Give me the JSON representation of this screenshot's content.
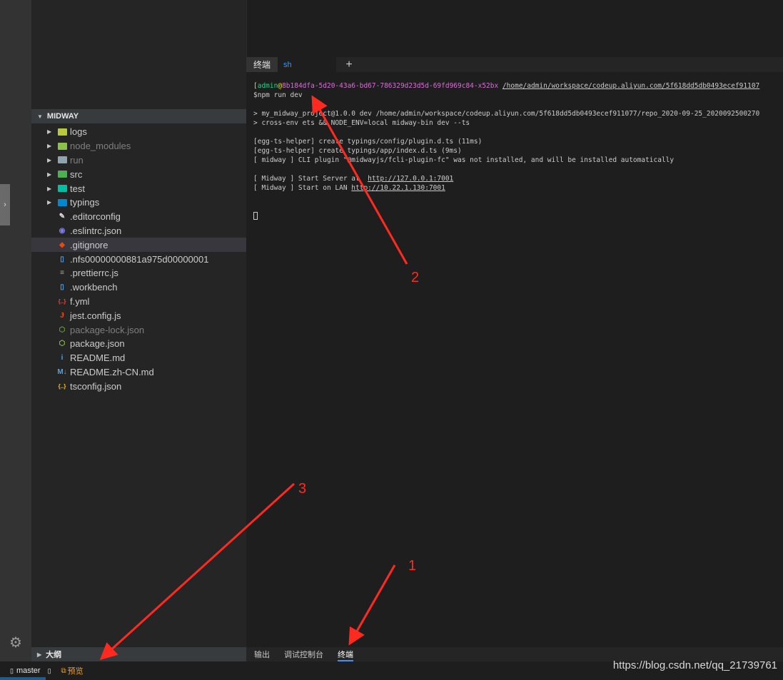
{
  "sidebar": {
    "section_title": "MIDWAY",
    "outline_title": "大纲",
    "items": [
      {
        "label": "logs",
        "type": "folder",
        "icon": "folder-logs-icon",
        "color": "#b8c93c",
        "dim": false
      },
      {
        "label": "node_modules",
        "type": "folder",
        "icon": "folder-node-icon",
        "color": "#8bc34a",
        "dim": true
      },
      {
        "label": "run",
        "type": "folder",
        "icon": "folder-icon",
        "color": "#90a4ae",
        "dim": true
      },
      {
        "label": "src",
        "type": "folder",
        "icon": "folder-src-icon",
        "color": "#4caf50",
        "dim": false
      },
      {
        "label": "test",
        "type": "folder",
        "icon": "folder-test-icon",
        "color": "#00bfa5",
        "dim": false
      },
      {
        "label": "typings",
        "type": "folder",
        "icon": "folder-typings-icon",
        "color": "#0288d1",
        "dim": false
      },
      {
        "label": ".editorconfig",
        "type": "file",
        "icon": "editorconfig-icon",
        "glyph": "✎",
        "color": "#e0e0e0",
        "dim": false
      },
      {
        "label": ".eslintrc.json",
        "type": "file",
        "icon": "eslint-icon",
        "glyph": "◉",
        "color": "#7c7ce5",
        "dim": false
      },
      {
        "label": ".gitignore",
        "type": "file",
        "icon": "git-icon",
        "glyph": "◆",
        "color": "#e64a19",
        "dim": false,
        "selected": true
      },
      {
        "label": ".nfs00000000881a975d00000001",
        "type": "file",
        "icon": "file-icon",
        "glyph": "▯",
        "color": "#42a5f5",
        "dim": false
      },
      {
        "label": ".prettierrc.js",
        "type": "file",
        "icon": "prettier-icon",
        "glyph": "≡",
        "color": "#c7a46b",
        "dim": false
      },
      {
        "label": ".workbench",
        "type": "file",
        "icon": "file-icon",
        "glyph": "▯",
        "color": "#42a5f5",
        "dim": false
      },
      {
        "label": "f.yml",
        "type": "file",
        "icon": "yaml-icon",
        "glyph": "{..}",
        "color": "#f44336",
        "dim": false
      },
      {
        "label": "jest.config.js",
        "type": "file",
        "icon": "jest-icon",
        "glyph": "Ɉ",
        "color": "#e64a19",
        "dim": false
      },
      {
        "label": "package-lock.json",
        "type": "file",
        "icon": "nodejs-icon",
        "glyph": "⬡",
        "color": "#689f38",
        "dim": true
      },
      {
        "label": "package.json",
        "type": "file",
        "icon": "nodejs-icon",
        "glyph": "⬡",
        "color": "#8bc34a",
        "dim": false
      },
      {
        "label": "README.md",
        "type": "file",
        "icon": "info-icon",
        "glyph": "i",
        "color": "#42a5f5",
        "dim": false
      },
      {
        "label": "README.zh-CN.md",
        "type": "file",
        "icon": "markdown-icon",
        "glyph": "M↓",
        "color": "#42a5f5",
        "dim": false
      },
      {
        "label": "tsconfig.json",
        "type": "file",
        "icon": "json-icon",
        "glyph": "{..}",
        "color": "#fbc02d",
        "dim": false
      }
    ]
  },
  "terminal": {
    "tabs": {
      "title": "终端",
      "session": "sh",
      "add": "+"
    },
    "prompt": {
      "bracket": "[",
      "user": "admin",
      "at": "@",
      "host": "8b184dfa-5d20-43a6-bd67-786329d23d5d-69fd969c84-x52bx",
      "path": "/home/admin/workspace/codeup.aliyun.com/5f618dd5db0493ecef91107"
    },
    "command": "$npm run dev",
    "lines_block1": [
      "> my_midway_project@1.0.0 dev /home/admin/workspace/codeup.aliyun.com/5f618dd5db0493ecef911077/repo_2020-09-25_2020092500270",
      "> cross-env ets && NODE_ENV=local midway-bin dev --ts"
    ],
    "lines_block2": [
      "[egg-ts-helper] create typings/config/plugin.d.ts (11ms)",
      "[egg-ts-helper] create typings/app/index.d.ts (9ms)",
      "[ midway ] CLI plugin \"@midwayjs/fcli-plugin-fc\" was not installed, and will be installed automatically"
    ],
    "server_line": {
      "prefix": "[ Midway ] Start Server at  ",
      "url": "http://127.0.0.1:7001"
    },
    "lan_line": {
      "prefix": "[ Midway ] Start on LAN ",
      "url": "http://10.22.1.130:7001"
    }
  },
  "panel": {
    "tabs": [
      "输出",
      "调试控制台",
      "终端"
    ],
    "active": "终端"
  },
  "statusbar": {
    "branch": "master",
    "preview": "预览"
  },
  "watermark": "https://blog.csdn.net/qq_21739761",
  "annotations": [
    "1",
    "2",
    "3"
  ],
  "colors": {
    "arrow": "#ff2a1f",
    "accent": "#3794ff"
  }
}
